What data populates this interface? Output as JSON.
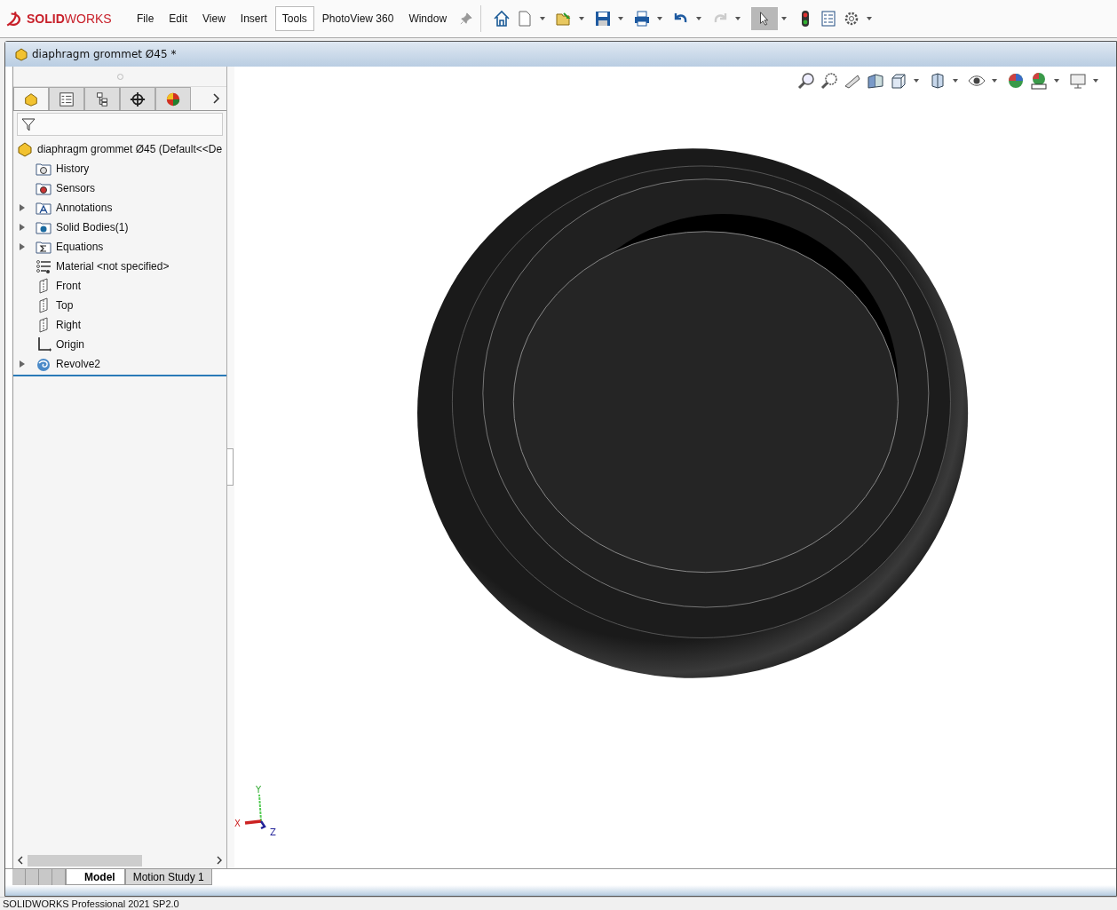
{
  "app": {
    "logo": "**SOLID**WORKS"
  },
  "menu": [
    {
      "label": "File",
      "selected": false
    },
    {
      "label": "Edit",
      "selected": false
    },
    {
      "label": "View",
      "selected": false
    },
    {
      "label": "Insert",
      "selected": false
    },
    {
      "label": "Tools",
      "selected": true
    },
    {
      "label": "PhotoView 360",
      "selected": false
    },
    {
      "label": "Window",
      "selected": false
    }
  ],
  "toolbar": {
    "select_active": true
  },
  "document": {
    "title": "diaphragm grommet Ø45 *"
  },
  "panel_tabs": [
    {
      "kind": "feature",
      "selected": true
    },
    {
      "kind": "property",
      "selected": false
    },
    {
      "kind": "config",
      "selected": false
    },
    {
      "kind": "dimxpert",
      "selected": false
    },
    {
      "kind": "display",
      "selected": false
    }
  ],
  "tree": {
    "root": "diaphragm grommet Ø45  (Default<<De",
    "children": [
      {
        "label": "History",
        "kind": "history",
        "expandable": false
      },
      {
        "label": "Sensors",
        "kind": "sensors",
        "expandable": false
      },
      {
        "label": "Annotations",
        "kind": "annotations",
        "expandable": true
      },
      {
        "label": "Solid Bodies(1)",
        "kind": "bodies",
        "expandable": true
      },
      {
        "label": "Equations",
        "kind": "equations",
        "expandable": true
      },
      {
        "label": "Material <not specified>",
        "kind": "material",
        "expandable": false
      },
      {
        "label": "Front",
        "kind": "plane",
        "expandable": false
      },
      {
        "label": "Top",
        "kind": "plane",
        "expandable": false
      },
      {
        "label": "Right",
        "kind": "plane",
        "expandable": false
      },
      {
        "label": "Origin",
        "kind": "origin",
        "expandable": false
      },
      {
        "label": "Revolve2",
        "kind": "revolve",
        "expandable": true
      }
    ]
  },
  "triad": {
    "x": "X",
    "y": "Y",
    "z": "Z"
  },
  "bottom_tabs": [
    {
      "label": "Model",
      "selected": true
    },
    {
      "label": "Motion Study 1",
      "selected": false
    }
  ],
  "status_bar": "SOLIDWORKS Professional 2021 SP2.0"
}
